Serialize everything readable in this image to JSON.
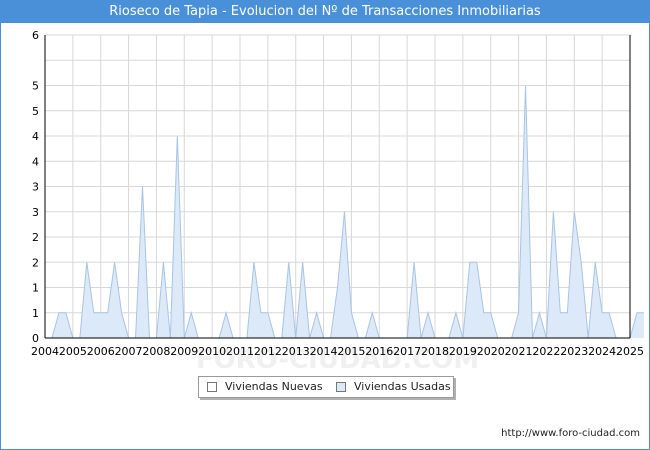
{
  "header": {
    "title": "Rioseco de Tapia - Evolucion del Nº de Transacciones Inmobiliarias"
  },
  "footer": {
    "url": "http://www.foro-ciudad.com"
  },
  "watermark": "FORO-CIUDAD.COM",
  "legend": {
    "placement": "bottom-center",
    "items": [
      {
        "label": "Viviendas Nuevas",
        "color": "#ffffff"
      },
      {
        "label": "Viviendas Usadas",
        "color": "#dce9f8"
      }
    ]
  },
  "colors": {
    "header": "#4a90d9",
    "area_fill": "#dce9f8",
    "area_stroke": "#a9c4e4",
    "grid": "#d8d8d8"
  },
  "chart_data": {
    "type": "area",
    "title": "Rioseco de Tapia - Evolucion del Nº de Transacciones Inmobiliarias",
    "xlabel": "",
    "ylabel": "",
    "grid": true,
    "ylim": [
      0,
      6
    ],
    "yticks": [
      0,
      0.5,
      1,
      1.5,
      2,
      2.5,
      3,
      3.5,
      4,
      4.5,
      5,
      5.5,
      6
    ],
    "ytick_labels": [
      "0",
      "1",
      "1",
      "2",
      "2",
      "3",
      "3",
      "4",
      "4",
      "5",
      "5",
      "6"
    ],
    "xlim": [
      2004,
      2025
    ],
    "xticks": [
      "2004",
      "2005",
      "2006",
      "2007",
      "2008",
      "2009",
      "2010",
      "2011",
      "2012",
      "2013",
      "2014",
      "2015",
      "2016",
      "2017",
      "2018",
      "2019",
      "2020",
      "2021",
      "2022",
      "2023",
      "2024",
      "2025"
    ],
    "x_step": 0.25,
    "series": [
      {
        "name": "Viviendas Nuevas",
        "values": [
          0,
          0,
          0,
          0,
          0,
          0,
          0,
          0,
          0,
          0,
          0,
          0,
          0,
          0,
          0,
          0,
          0,
          0,
          0,
          0,
          0,
          0,
          0,
          0,
          0,
          0,
          0,
          0,
          0,
          0,
          0,
          0,
          0,
          0,
          0,
          0,
          0,
          0,
          0,
          0,
          0,
          0,
          0,
          0,
          0,
          0,
          0,
          0,
          0,
          0,
          0,
          0,
          0,
          0,
          0,
          0,
          0,
          0,
          0,
          0,
          0,
          0,
          0,
          0,
          0,
          0,
          0,
          0,
          0,
          0,
          0,
          0,
          0,
          0,
          0,
          0,
          0,
          0,
          0,
          0,
          0,
          0,
          0,
          0,
          0
        ]
      },
      {
        "name": "Viviendas Usadas",
        "values": [
          0,
          0,
          0.5,
          0.5,
          0,
          0,
          1.5,
          0.5,
          0.5,
          0.5,
          1.5,
          0.5,
          0,
          0,
          3,
          0,
          0,
          1.5,
          0,
          4,
          0,
          0.5,
          0,
          0,
          0,
          0,
          0.5,
          0,
          0,
          0,
          1.5,
          0.5,
          0.5,
          0,
          0,
          1.5,
          0,
          1.5,
          0,
          0.5,
          0,
          0,
          1,
          2.5,
          0.5,
          0,
          0,
          0.5,
          0,
          0,
          0,
          0,
          0,
          1.5,
          0,
          0.5,
          0,
          0,
          0,
          0.5,
          0,
          1.5,
          1.5,
          0.5,
          0.5,
          0,
          0,
          0,
          0.5,
          5,
          0,
          0.5,
          0,
          2.5,
          0.5,
          0.5,
          2.5,
          1.5,
          0,
          1.5,
          0.5,
          0.5,
          0,
          0,
          0,
          0.5,
          0.5
        ]
      }
    ]
  }
}
